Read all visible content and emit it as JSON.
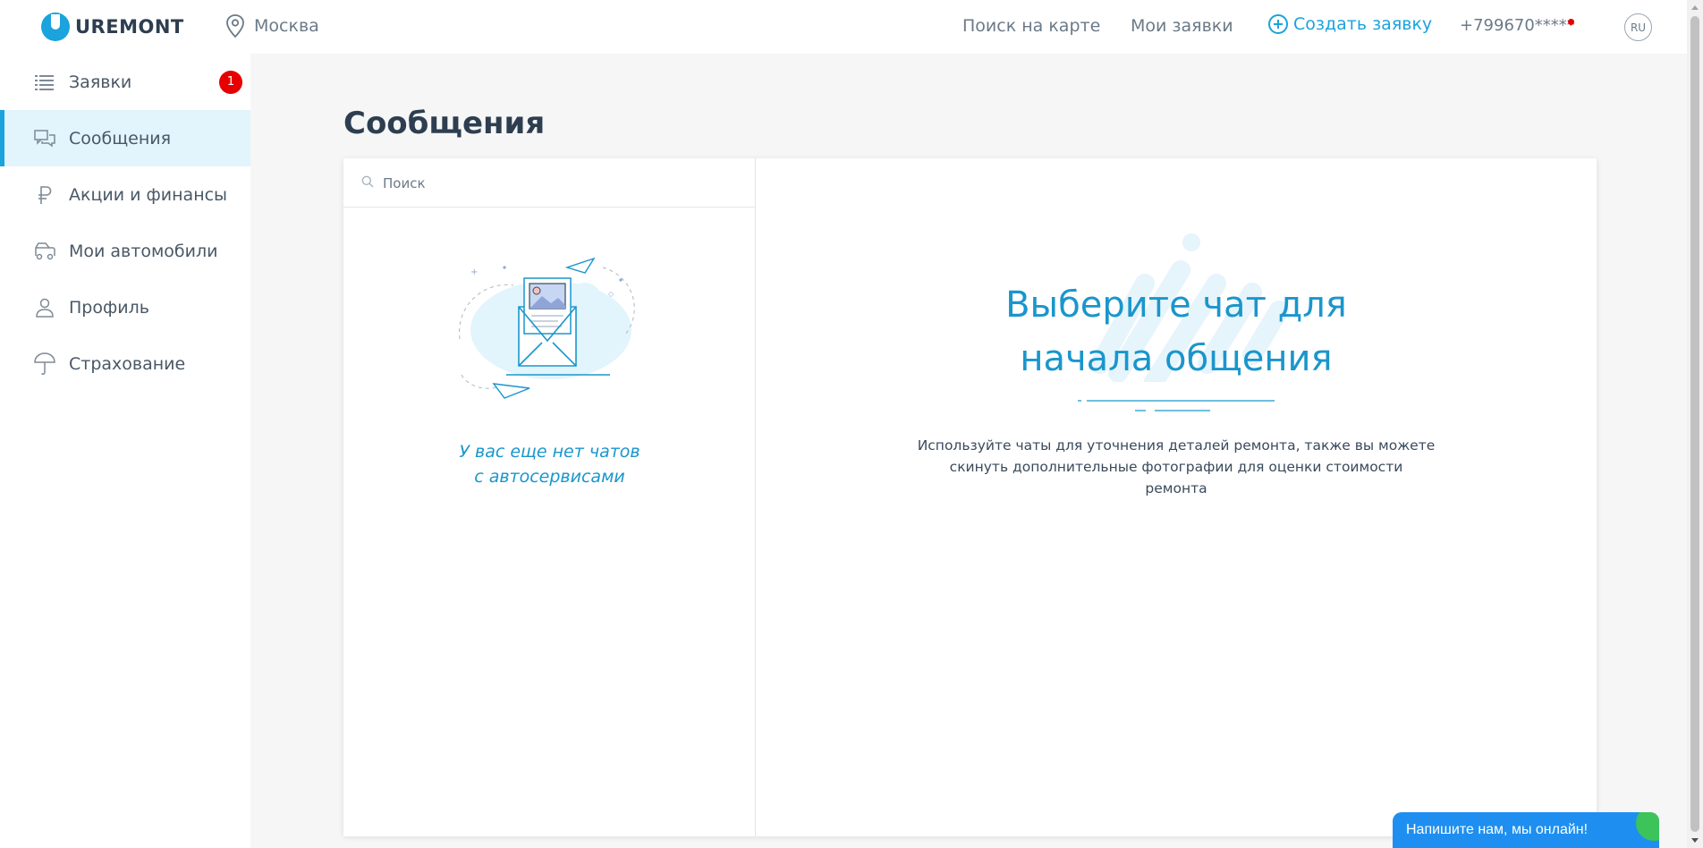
{
  "header": {
    "logo_text": "UREMONT",
    "city": "Москва",
    "nav_map": "Поиск на карте",
    "nav_my_requests": "Мои заявки",
    "nav_create": "Создать заявку",
    "phone": "+799670*****",
    "lang": "RU"
  },
  "sidebar": {
    "items": [
      {
        "label": "Заявки",
        "icon": "list-icon",
        "badge": "1"
      },
      {
        "label": "Сообщения",
        "icon": "chat-icon",
        "active": true
      },
      {
        "label": "Акции и финансы",
        "icon": "ruble-icon"
      },
      {
        "label": "Мои автомобили",
        "icon": "car-icon"
      },
      {
        "label": "Профиль",
        "icon": "user-icon"
      },
      {
        "label": "Страхование",
        "icon": "umbrella-icon"
      }
    ]
  },
  "main": {
    "title": "Сообщения",
    "search_placeholder": "Поиск",
    "empty_line1": "У вас еще нет чатов",
    "empty_line2": "с автосервисами",
    "choose_line1": "Выберите чат для",
    "choose_line2": "начала общения",
    "choose_desc_line1": "Используйте чаты для уточнения деталей ремонта, также вы можете",
    "choose_desc_line2": "скинуть дополнительные фотографии для оценки стоимости",
    "choose_desc_line3": "ремонта"
  },
  "chat_widget": {
    "label": "Напишите нам, мы онлайн!"
  },
  "colors": {
    "accent": "#1aa3dc",
    "badge": "#e60000",
    "widget": "#1e8ff0",
    "active_bg": "#e2f4fc"
  }
}
